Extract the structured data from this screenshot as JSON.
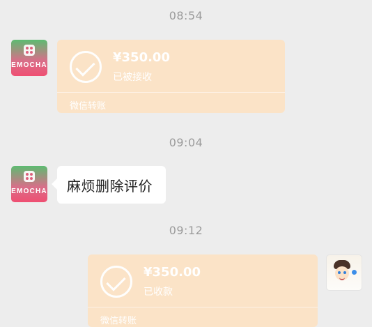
{
  "chat": {
    "timestamps": [
      "08:54",
      "09:04",
      "09:12"
    ],
    "messages": [
      {
        "sender": "merchant",
        "type": "transfer",
        "amount": "¥350.00",
        "status": "已被接收",
        "footer": "微信转账",
        "avatar_text": "EMOCHA"
      },
      {
        "sender": "merchant",
        "type": "text",
        "text": "麻烦删除评价",
        "avatar_text": "EMOCHA"
      },
      {
        "sender": "self",
        "type": "transfer",
        "amount": "¥350.00",
        "status": "已收款",
        "footer": "微信转账"
      }
    ]
  }
}
